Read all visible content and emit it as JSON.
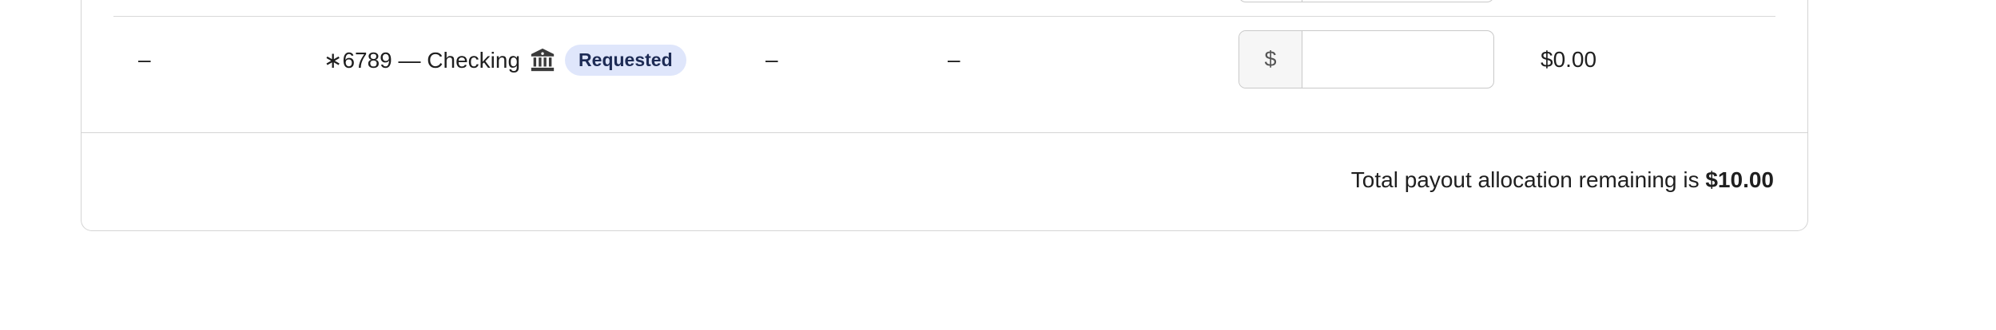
{
  "payout_row": {
    "col1": "–",
    "account_label": "∗6789 — Checking",
    "account_icon": "bank-icon",
    "status_badge": "Requested",
    "col4": "–",
    "col5": "–",
    "amount_prefix": "$",
    "amount_value": "",
    "amount_placeholder": "",
    "allocated": "$0.00"
  },
  "footer": {
    "remaining_text": "Total payout allocation remaining is",
    "remaining_amount": "$10.00"
  },
  "colors": {
    "badge_bg": "#dfe6fb",
    "badge_text": "#1d2b55",
    "border": "#d4d4d4"
  }
}
